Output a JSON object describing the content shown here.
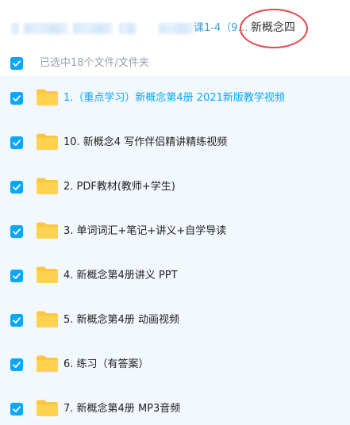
{
  "breadcrumb": {
    "partial_text": "课1-4（9…",
    "current": "新概念四"
  },
  "select_all": {
    "label": "已选中18个文件/文件夹",
    "checked": true
  },
  "files": [
    {
      "name": "1.（重点学习）新概念第4册 2021新版教学视频",
      "checked": true,
      "icon": "folder-icon"
    },
    {
      "name": "10. 新概念4 写作伴侣精讲精练视频",
      "checked": true,
      "icon": "folder-icon"
    },
    {
      "name": "2. PDF教材(教师+学生)",
      "checked": true,
      "icon": "folder-icon"
    },
    {
      "name": "3. 单词词汇+笔记+讲义+自学导读",
      "checked": true,
      "icon": "folder-icon"
    },
    {
      "name": "4. 新概念第4册讲义 PPT",
      "checked": true,
      "icon": "folder-icon"
    },
    {
      "name": "5. 新概念第4册 动画视频",
      "checked": true,
      "icon": "folder-icon"
    },
    {
      "name": "6. 练习（有答案）",
      "checked": true,
      "icon": "folder-icon"
    },
    {
      "name": "7. 新概念第4册 MP3音频",
      "checked": true,
      "icon": "folder-icon"
    }
  ],
  "colors": {
    "accent": "#06a7ff",
    "folder": "#ffc63d",
    "row_bg": "#f2f8fe",
    "annotation_circle": "#e0474c"
  }
}
